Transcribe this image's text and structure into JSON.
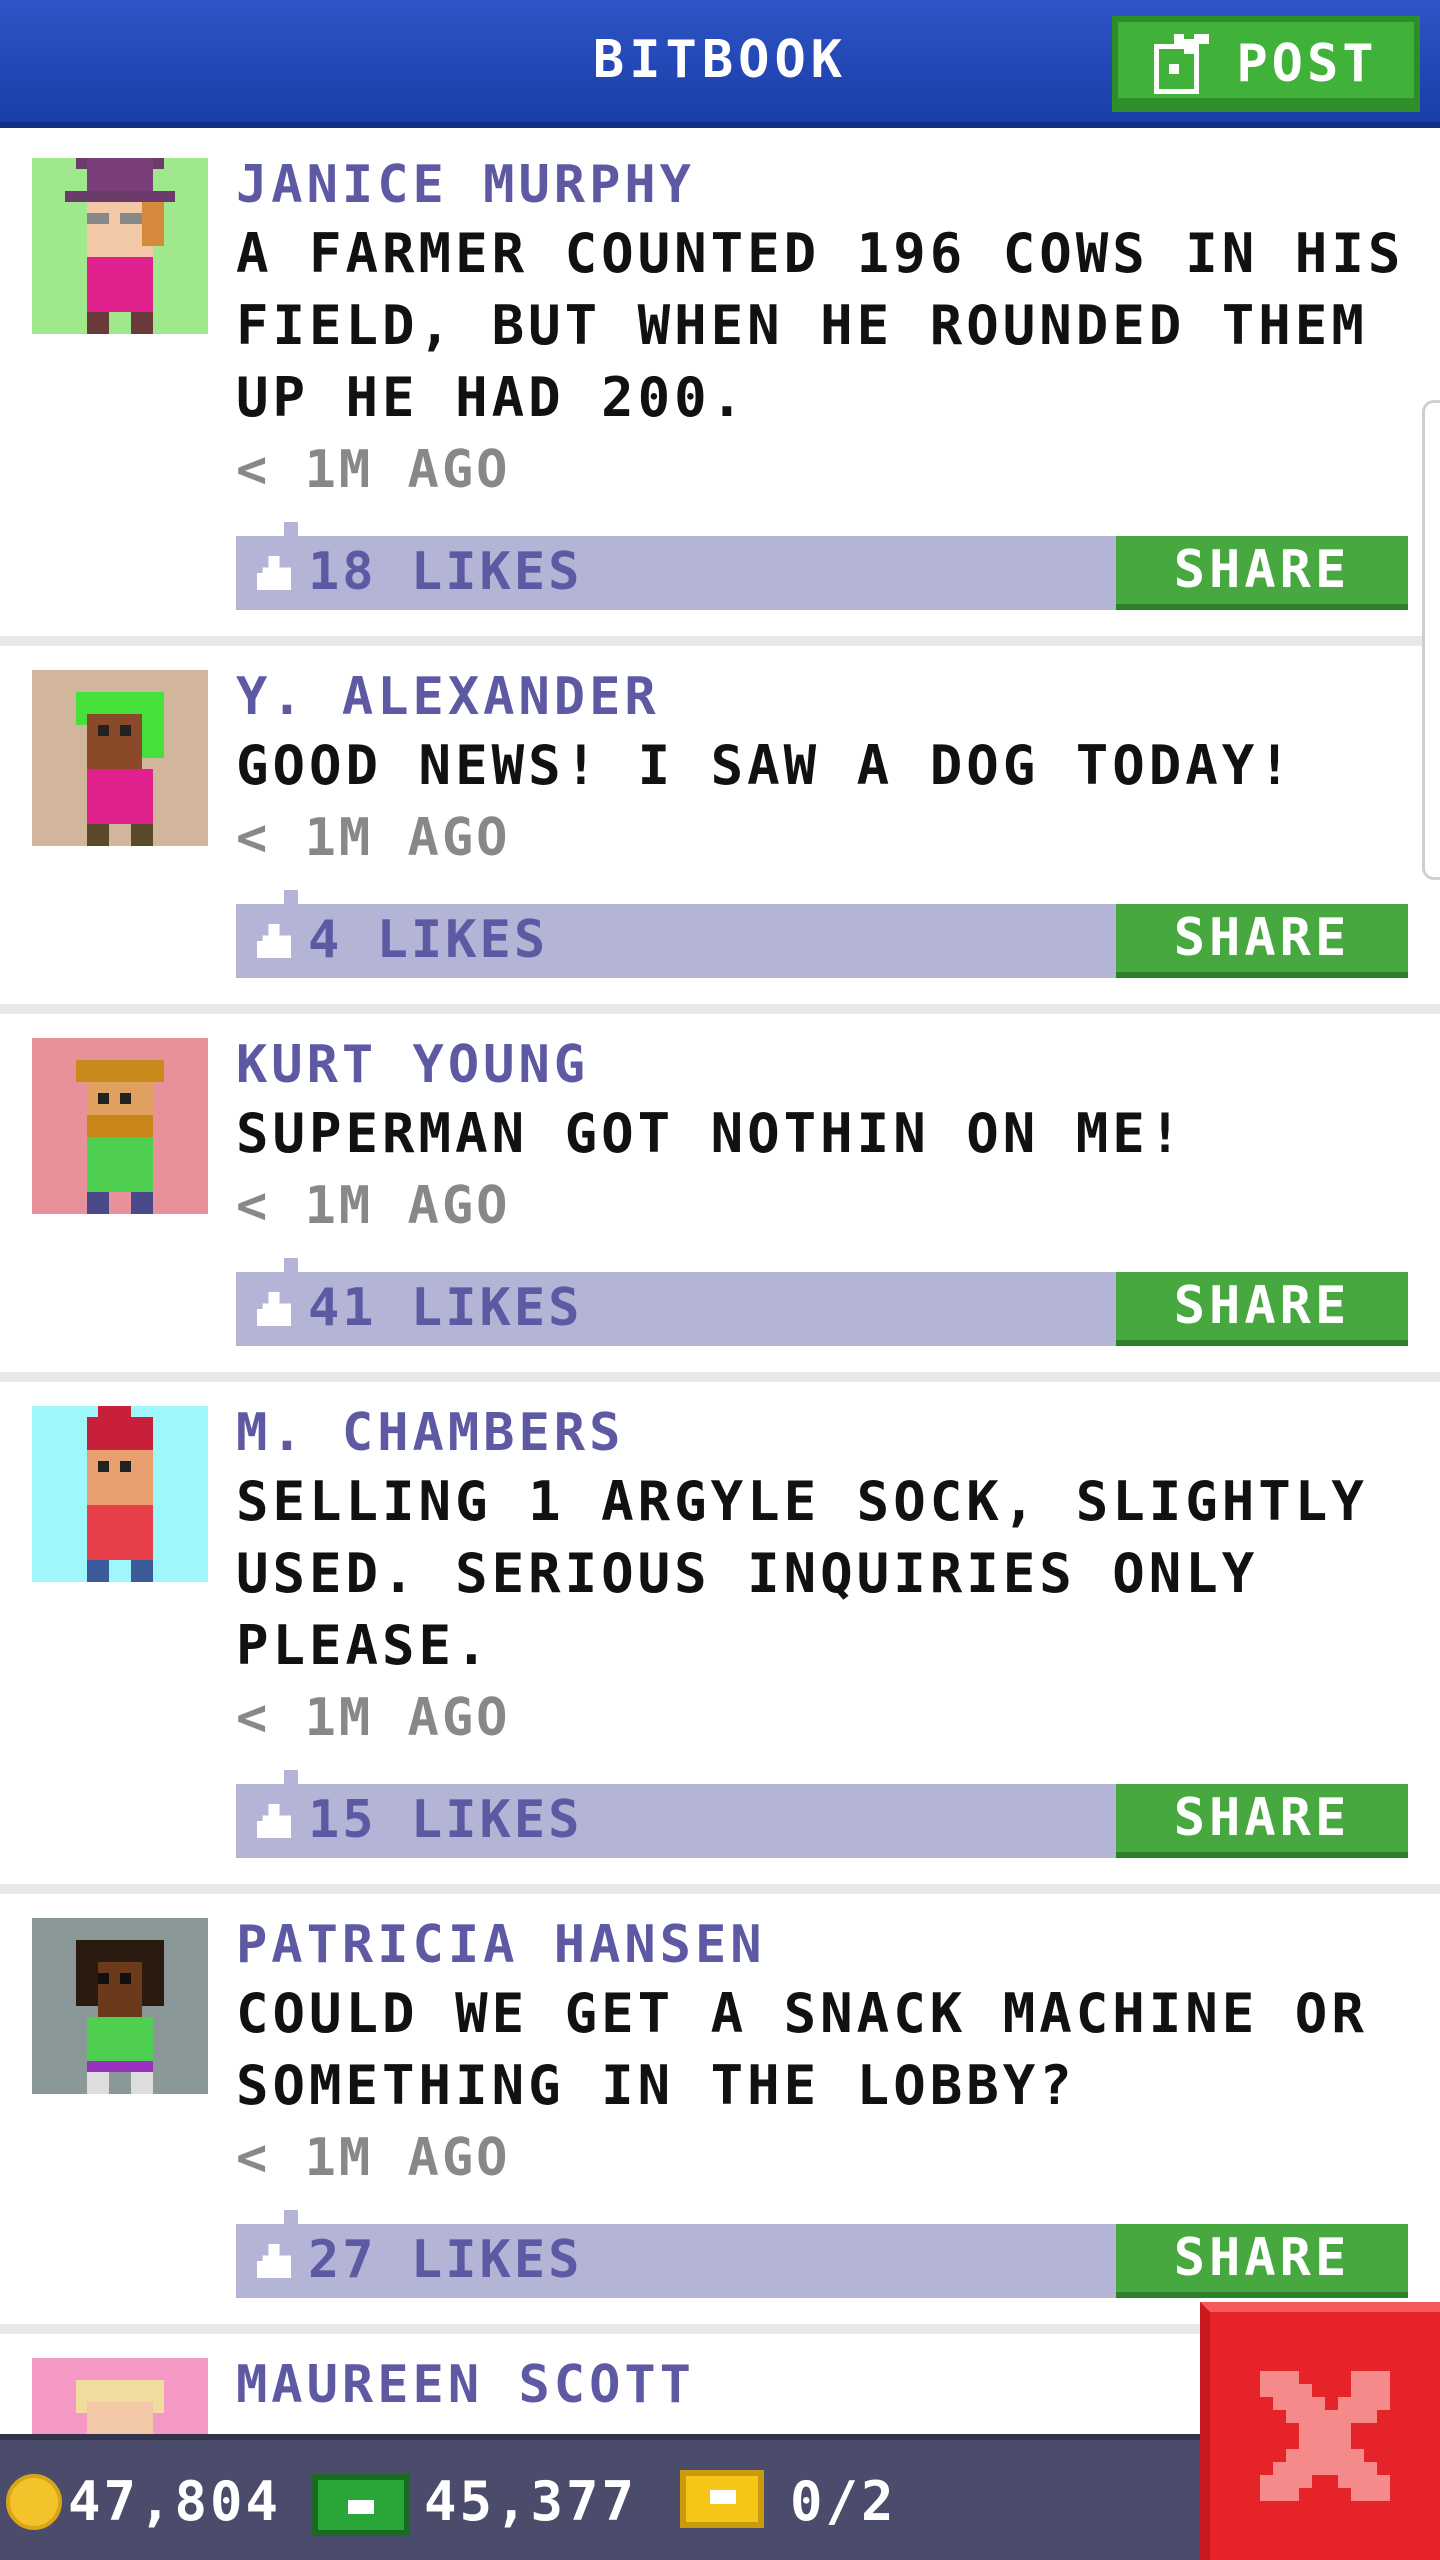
{
  "header": {
    "title": "BITBOOK",
    "post_label": "POST"
  },
  "posts": [
    {
      "author": "JANICE MURPHY",
      "message": "A FARMER COUNTED 196 COWS IN HIS FIELD, BUT WHEN HE ROUNDED THEM UP HE HAD 200.",
      "time": "< 1M AGO",
      "likes": "18 LIKES",
      "share": "SHARE",
      "avatar_bg": "#a0e88c"
    },
    {
      "author": "Y. ALEXANDER",
      "message": "GOOD NEWS! I SAW A DOG TODAY!",
      "time": "< 1M AGO",
      "likes": "4 LIKES",
      "share": "SHARE",
      "avatar_bg": "#d2b69c"
    },
    {
      "author": "KURT YOUNG",
      "message": "SUPERMAN GOT NOTHIN ON ME!",
      "time": "< 1M AGO",
      "likes": "41 LIKES",
      "share": "SHARE",
      "avatar_bg": "#e8919a"
    },
    {
      "author": "M. CHAMBERS",
      "message": "SELLING 1 ARGYLE SOCK, SLIGHTLY USED. SERIOUS INQUIRIES ONLY PLEASE.",
      "time": "< 1M AGO",
      "likes": "15 LIKES",
      "share": "SHARE",
      "avatar_bg": "#9ff6fb"
    },
    {
      "author": "PATRICIA HANSEN",
      "message": "COULD WE GET A SNACK MACHINE OR SOMETHING IN THE LOBBY?",
      "time": "< 1M AGO",
      "likes": "27 LIKES",
      "share": "SHARE",
      "avatar_bg": "#8a9898"
    },
    {
      "author": "MAUREEN SCOTT",
      "avatar_bg": "#f49ac4"
    }
  ],
  "status_bar": {
    "coins": "47,804",
    "bux": "45,377",
    "tickets": "0/2"
  },
  "colors": {
    "header_blue": "#2447b8",
    "post_green": "#40b23a",
    "likes_bar": "#b4b4d6",
    "author_purple": "#5d5aa3",
    "close_red": "#e52328"
  },
  "icons": {
    "post": "edit-icon",
    "like": "thumbs-up-icon",
    "coin": "coin-icon",
    "bux": "cash-icon",
    "ticket": "ticket-icon",
    "close": "close-icon"
  }
}
